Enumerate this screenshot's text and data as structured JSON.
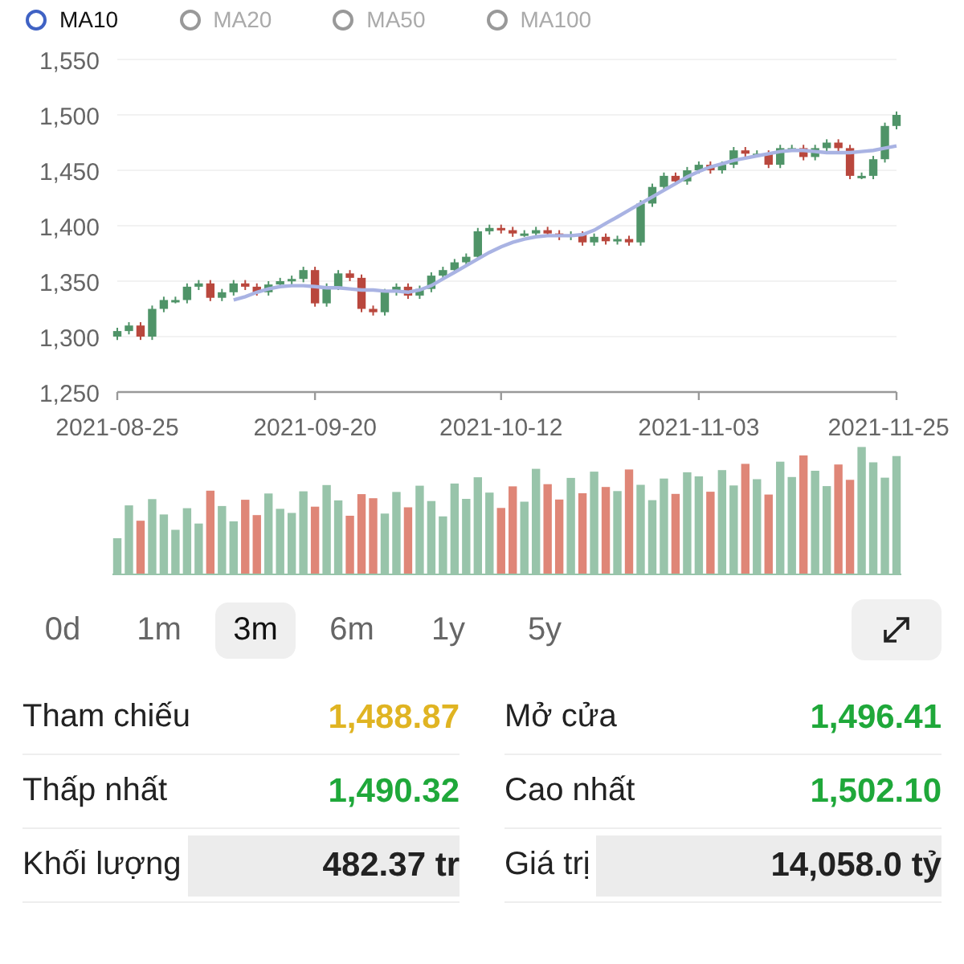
{
  "ma_options": [
    {
      "label": "MA10",
      "selected": true
    },
    {
      "label": "MA20",
      "selected": false
    },
    {
      "label": "MA50",
      "selected": false
    },
    {
      "label": "MA100",
      "selected": false
    }
  ],
  "price_chart": {
    "chart_data": {
      "type": "candlestick",
      "grid": true,
      "ylim": [
        1250,
        1550
      ],
      "yticks": [
        {
          "value": 1250,
          "label": "1,250"
        },
        {
          "value": 1300,
          "label": "1,300"
        },
        {
          "value": 1350,
          "label": "1,350"
        },
        {
          "value": 1400,
          "label": "1,400"
        },
        {
          "value": 1450,
          "label": "1,450"
        },
        {
          "value": 1500,
          "label": "1,500"
        },
        {
          "value": 1550,
          "label": "1,550"
        }
      ],
      "categories": [
        "2021-08-25",
        null,
        null,
        null,
        null,
        null,
        null,
        null,
        null,
        null,
        null,
        null,
        null,
        null,
        null,
        null,
        null,
        "2021-09-20",
        null,
        null,
        null,
        null,
        null,
        null,
        null,
        null,
        null,
        null,
        null,
        null,
        null,
        null,
        null,
        "2021-10-12",
        null,
        null,
        null,
        null,
        null,
        null,
        null,
        null,
        null,
        null,
        null,
        null,
        null,
        null,
        null,
        null,
        "2021-11-03",
        null,
        null,
        null,
        null,
        null,
        null,
        null,
        null,
        null,
        null,
        null,
        null,
        null,
        null,
        null,
        null,
        "2021-11-25"
      ],
      "ohlc": [
        [
          1300,
          1308,
          1297,
          1305
        ],
        [
          1305,
          1313,
          1302,
          1310
        ],
        [
          1310,
          1313,
          1297,
          1300
        ],
        [
          1300,
          1328,
          1297,
          1325
        ],
        [
          1325,
          1336,
          1322,
          1333
        ],
        [
          1333,
          1336,
          1330,
          1333
        ],
        [
          1333,
          1348,
          1330,
          1345
        ],
        [
          1345,
          1351,
          1342,
          1348
        ],
        [
          1348,
          1351,
          1332,
          1335
        ],
        [
          1335,
          1343,
          1332,
          1340
        ],
        [
          1340,
          1351,
          1337,
          1348
        ],
        [
          1348,
          1351,
          1342,
          1345
        ],
        [
          1345,
          1348,
          1337,
          1340
        ],
        [
          1340,
          1350,
          1337,
          1347
        ],
        [
          1347,
          1353,
          1344,
          1350
        ],
        [
          1350,
          1355,
          1347,
          1352
        ],
        [
          1352,
          1363,
          1349,
          1360
        ],
        [
          1360,
          1363,
          1327,
          1330
        ],
        [
          1330,
          1348,
          1327,
          1345
        ],
        [
          1345,
          1360,
          1342,
          1357
        ],
        [
          1357,
          1360,
          1350,
          1353
        ],
        [
          1353,
          1356,
          1322,
          1325
        ],
        [
          1325,
          1328,
          1319,
          1322
        ],
        [
          1322,
          1343,
          1319,
          1340
        ],
        [
          1340,
          1348,
          1337,
          1345
        ],
        [
          1345,
          1348,
          1334,
          1337
        ],
        [
          1337,
          1346,
          1334,
          1343
        ],
        [
          1343,
          1358,
          1340,
          1355
        ],
        [
          1355,
          1363,
          1352,
          1360
        ],
        [
          1360,
          1370,
          1357,
          1367
        ],
        [
          1367,
          1375,
          1364,
          1372
        ],
        [
          1372,
          1398,
          1369,
          1395
        ],
        [
          1395,
          1401,
          1392,
          1398
        ],
        [
          1398,
          1401,
          1393,
          1396
        ],
        [
          1396,
          1399,
          1390,
          1393
        ],
        [
          1393,
          1396,
          1390,
          1393
        ],
        [
          1393,
          1399,
          1390,
          1396
        ],
        [
          1396,
          1399,
          1390,
          1393
        ],
        [
          1393,
          1396,
          1387,
          1390
        ],
        [
          1390,
          1395,
          1387,
          1392
        ],
        [
          1392,
          1395,
          1382,
          1385
        ],
        [
          1385,
          1393,
          1382,
          1390
        ],
        [
          1390,
          1393,
          1383,
          1386
        ],
        [
          1386,
          1391,
          1383,
          1388
        ],
        [
          1388,
          1391,
          1382,
          1385
        ],
        [
          1385,
          1423,
          1382,
          1420
        ],
        [
          1420,
          1438,
          1417,
          1435
        ],
        [
          1435,
          1448,
          1432,
          1445
        ],
        [
          1445,
          1448,
          1437,
          1440
        ],
        [
          1440,
          1453,
          1437,
          1450
        ],
        [
          1450,
          1458,
          1447,
          1455
        ],
        [
          1455,
          1458,
          1447,
          1450
        ],
        [
          1450,
          1458,
          1447,
          1455
        ],
        [
          1455,
          1471,
          1452,
          1468
        ],
        [
          1468,
          1471,
          1462,
          1465
        ],
        [
          1465,
          1468,
          1462,
          1465
        ],
        [
          1465,
          1468,
          1452,
          1455
        ],
        [
          1455,
          1473,
          1452,
          1470
        ],
        [
          1470,
          1473,
          1467,
          1470
        ],
        [
          1470,
          1473,
          1459,
          1462
        ],
        [
          1462,
          1473,
          1459,
          1470
        ],
        [
          1470,
          1478,
          1467,
          1475
        ],
        [
          1475,
          1478,
          1467,
          1470
        ],
        [
          1470,
          1473,
          1442,
          1445
        ],
        [
          1445,
          1448,
          1442,
          1445
        ],
        [
          1445,
          1463,
          1442,
          1460
        ],
        [
          1460,
          1493,
          1457,
          1490
        ],
        [
          1490,
          1503,
          1487,
          1500
        ]
      ],
      "series": [
        {
          "type": "line",
          "color": "#a9b3e3",
          "values": [
            null,
            null,
            null,
            null,
            null,
            null,
            null,
            null,
            null,
            null,
            1333,
            1336,
            1340,
            1343,
            1345,
            1346,
            1346,
            1345,
            1344,
            1344,
            1343,
            1342,
            1342,
            1341,
            1341,
            1340,
            1342,
            1346,
            1352,
            1358,
            1364,
            1370,
            1376,
            1381,
            1385,
            1388,
            1390,
            1391,
            1391,
            1391,
            1392,
            1396,
            1402,
            1408,
            1414,
            1420,
            1426,
            1432,
            1438,
            1444,
            1449,
            1453,
            1456,
            1459,
            1461,
            1463,
            1465,
            1467,
            1468,
            1468,
            1467,
            1466,
            1466,
            1466,
            1467,
            1468,
            1470,
            1472
          ]
        }
      ]
    }
  },
  "periods": [
    {
      "label": "0d",
      "selected": false
    },
    {
      "label": "1m",
      "selected": false
    },
    {
      "label": "3m",
      "selected": true
    },
    {
      "label": "6m",
      "selected": false
    },
    {
      "label": "1y",
      "selected": false
    },
    {
      "label": "5y",
      "selected": false
    }
  ],
  "stats": [
    {
      "label": "Tham chiếu",
      "value": "1,488.87",
      "color": "#e0b422",
      "shaded": false
    },
    {
      "label": "Mở cửa",
      "value": "1,496.41",
      "color": "#1fa83a",
      "shaded": false
    },
    {
      "label": "Thấp nhất",
      "value": "1,490.32",
      "color": "#1fa83a",
      "shaded": false
    },
    {
      "label": "Cao nhất",
      "value": "1,502.10",
      "color": "#1fa83a",
      "shaded": false
    },
    {
      "label": "Khối lượng",
      "value": "482.37 tr",
      "color": "#222222",
      "shaded": true
    },
    {
      "label": "Giá trị",
      "value": "14,058.0 tỷ",
      "color": "#222222",
      "shaded": true
    }
  ]
}
